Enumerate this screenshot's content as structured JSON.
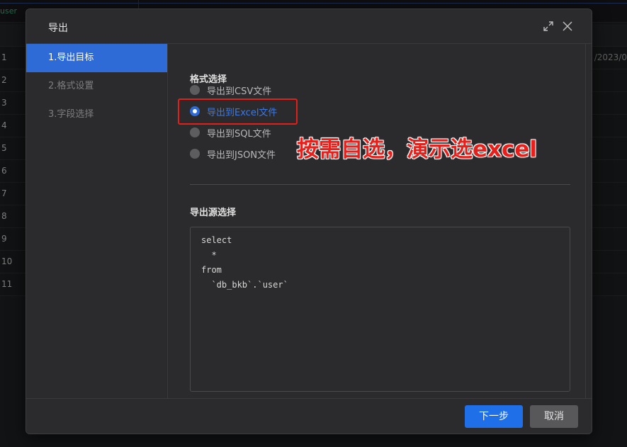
{
  "background": {
    "tab_label": "user",
    "row_numbers": [
      "1",
      "2",
      "3",
      "4",
      "5",
      "6",
      "7",
      "8",
      "9",
      "10",
      "11"
    ],
    "first_row_right_value": "/2023/0"
  },
  "dialog": {
    "title": "导出",
    "steps": [
      {
        "label": "1.导出目标",
        "active": true
      },
      {
        "label": "2.格式设置",
        "active": false
      },
      {
        "label": "3.字段选择",
        "active": false
      }
    ],
    "format_section_title": "格式选择",
    "format_options": [
      {
        "label": "导出到CSV文件",
        "checked": false
      },
      {
        "label": "导出到Excel文件",
        "checked": true
      },
      {
        "label": "导出到SQL文件",
        "checked": false
      },
      {
        "label": "导出到JSON文件",
        "checked": false
      }
    ],
    "source_section_title": "导出源选择",
    "sql_lines": [
      "select",
      "  *",
      "from",
      "  `db_bkb`.`user`"
    ],
    "next_button": "下一步",
    "cancel_button": "取消"
  },
  "annotation": {
    "text": "按需自选，演示选excel",
    "color": "#e8201b"
  },
  "colors": {
    "accent": "#2f6bd6",
    "primary_button": "#1e6fe8",
    "highlight": "#e0201b"
  },
  "icons": {
    "maximize": "expand-icon",
    "close": "close-icon"
  }
}
